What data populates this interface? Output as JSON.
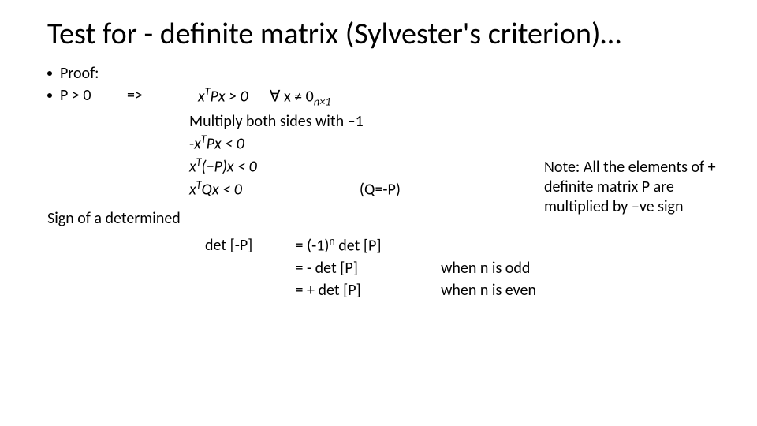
{
  "title": "Test for - definite matrix (Sylvester's criterion)…",
  "bullets": {
    "proof": "Proof:",
    "p_gt_0": "P > 0",
    "implies": "=>"
  },
  "math": {
    "line1_a": "x",
    "line1_sup": "T",
    "line1_b": "Px > 0",
    "line1_forall": "∀ x ≠ 0",
    "line1_dim": "n×1",
    "multiply": "Multiply both sides with –1",
    "line2_neg": "-",
    "line2_a": "x",
    "line2_sup": "T",
    "line2_b": "Px < 0",
    "line3_a": "x",
    "line3_sup": "T",
    "line3_b": "(−P)x < 0",
    "line4_a": "x",
    "line4_sup": "T",
    "line4_b": "Qx < 0",
    "line4_note": "(Q=-P)"
  },
  "sign_heading": "Sign of a determined",
  "det": {
    "row1_l": "det [-P]",
    "row1_e": "= (-1)",
    "row1_sup": "n",
    "row1_e2": " det [P]",
    "row2_l": "",
    "row2_e": "= - det [P]",
    "row2_c": "when n is odd",
    "row3_l": "",
    "row3_e": "= + det [P]",
    "row3_c": "when n is even"
  },
  "note": "Note: All the elements of + definite matrix P are multiplied by –ve sign"
}
